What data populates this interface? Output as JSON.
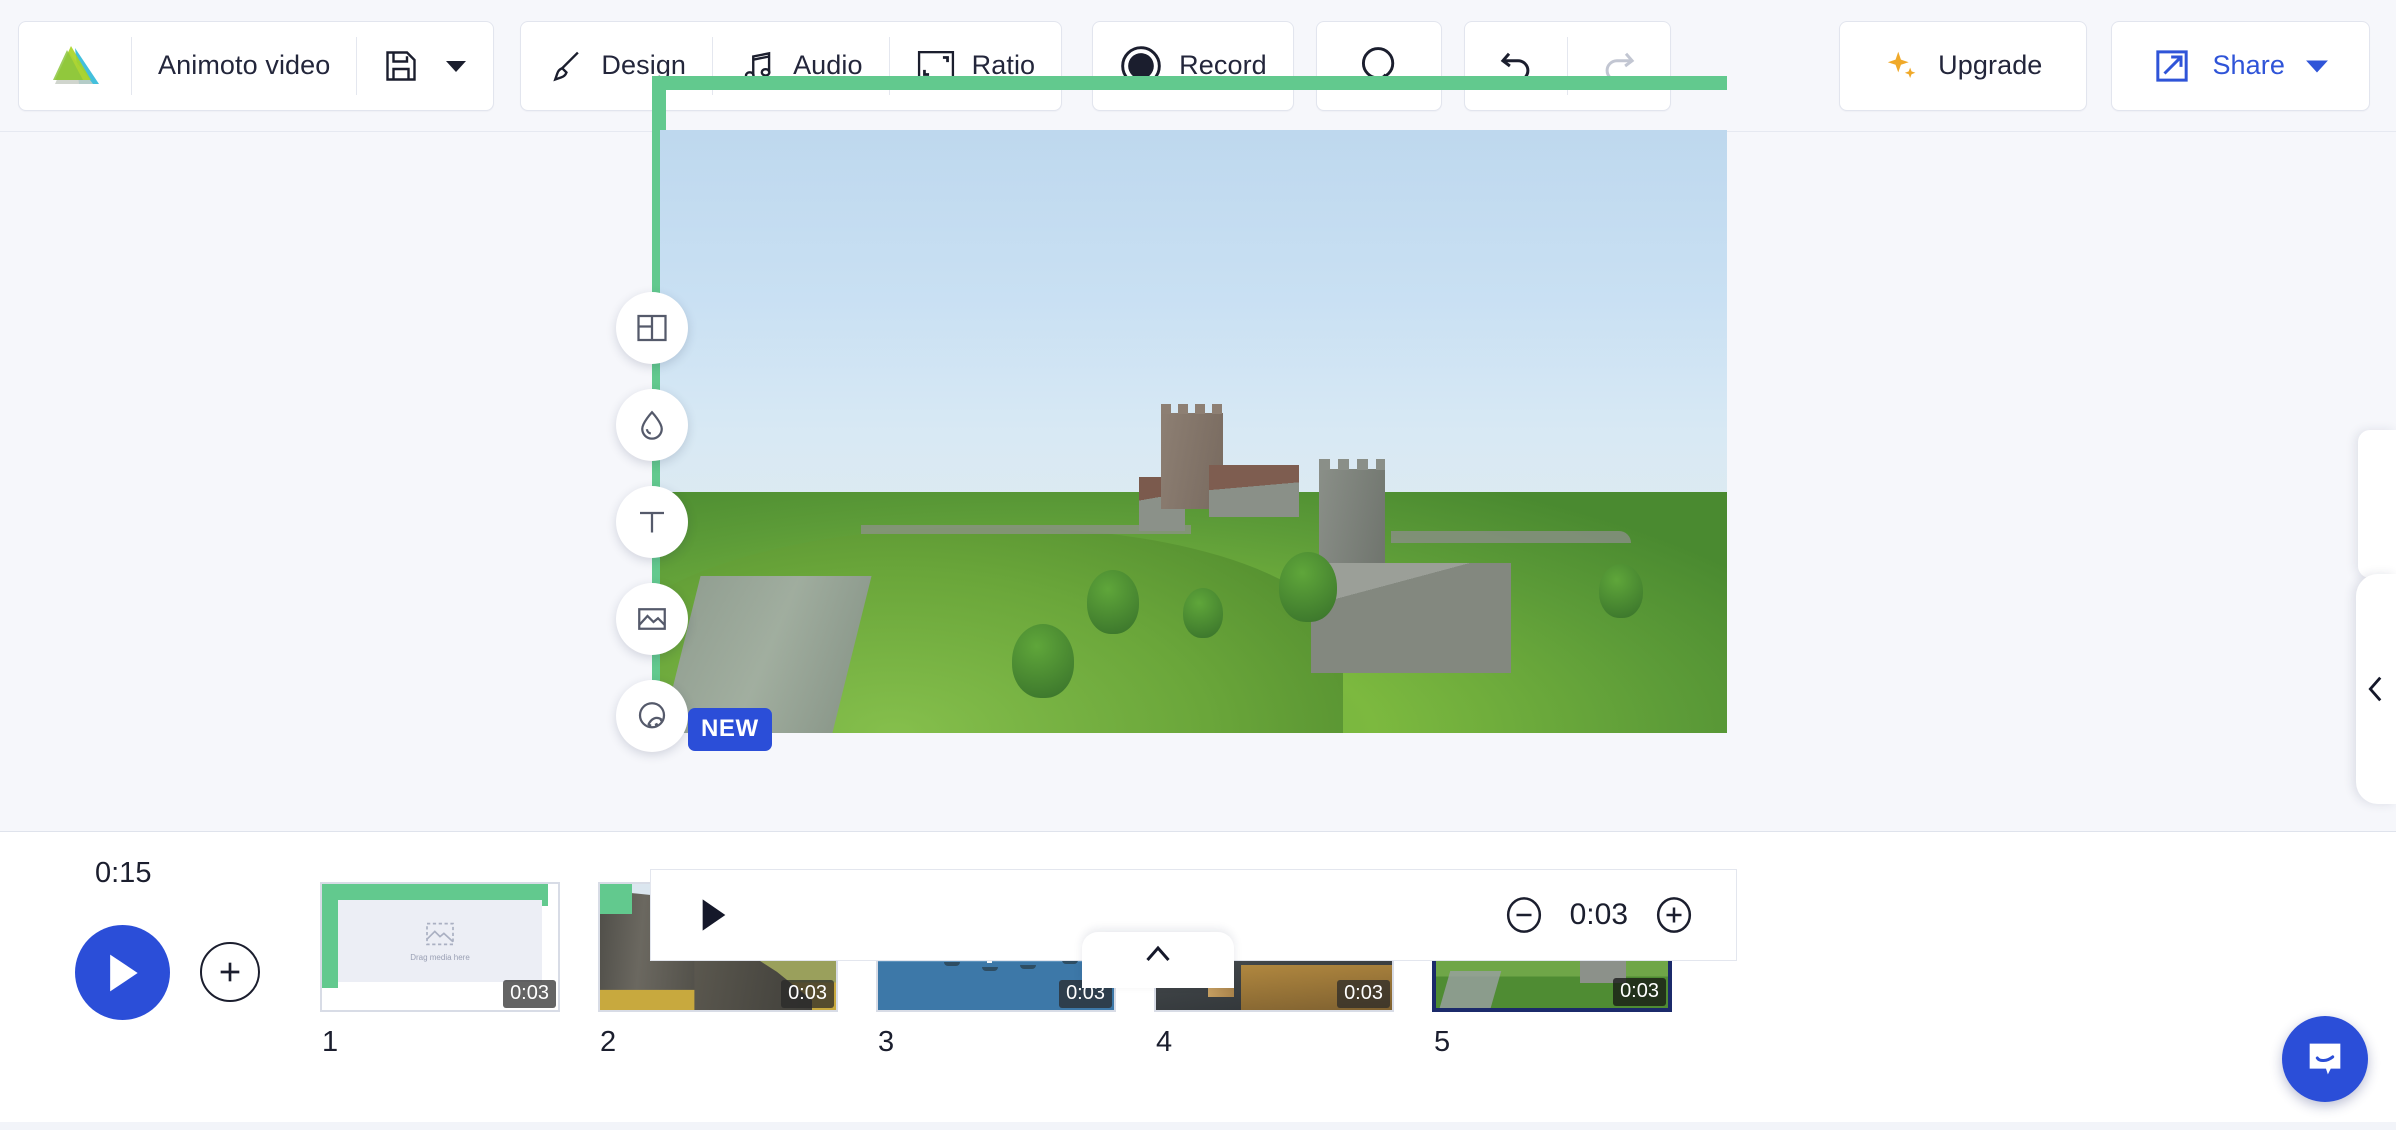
{
  "toolbar": {
    "logo_name": "animoto-logo",
    "project_title": "Animoto video",
    "save_icon": "floppy-disk-icon",
    "save_caret": "▼",
    "design_label": "Design",
    "audio_label": "Audio",
    "ratio_label": "Ratio",
    "record_label": "Record",
    "search_icon": "search-icon",
    "undo_icon": "undo-icon",
    "redo_icon": "redo-icon",
    "upgrade_label": "Upgrade",
    "share_label": "Share",
    "share_caret": "▼",
    "accent_blue": "#2f54d8",
    "upgrade_gold": "#f0a929"
  },
  "tool_rail": {
    "items": [
      {
        "name": "layout-icon",
        "label": "Layout"
      },
      {
        "name": "color-droplet-icon",
        "label": "Color"
      },
      {
        "name": "text-icon",
        "label": "Text"
      },
      {
        "name": "image-icon",
        "label": "Media"
      },
      {
        "name": "motion-icon",
        "label": "Motion"
      }
    ],
    "new_badge": "NEW"
  },
  "canvas": {
    "scene_description": "Dover Castle on green hills overlooking the sea",
    "selection_color": "#62c98e"
  },
  "player": {
    "play_icon": "play-icon",
    "decrease_icon": "minus-circle-icon",
    "increase_icon": "plus-circle-icon",
    "duration": "0:03",
    "expand_icon": "chevron-up-icon"
  },
  "timeline": {
    "total_duration": "0:15",
    "play_label": "play-icon",
    "add_label": "plus-icon",
    "scenes": [
      {
        "number": "1",
        "duration": "0:03",
        "placeholder": "Drag media here",
        "selected": false,
        "art": "placeholder"
      },
      {
        "number": "2",
        "duration": "0:03",
        "selected": false,
        "art": "cliff"
      },
      {
        "number": "3",
        "duration": "0:03",
        "selected": false,
        "art": "sailboats"
      },
      {
        "number": "4",
        "duration": "0:03",
        "selected": false,
        "art": "bigben"
      },
      {
        "number": "5",
        "duration": "0:03",
        "selected": true,
        "art": "castle"
      }
    ]
  },
  "side_panel": {
    "collapse_icon": "chevron-left-icon"
  },
  "chat": {
    "icon": "chat-bubble-icon",
    "color": "#2b4ed8"
  }
}
